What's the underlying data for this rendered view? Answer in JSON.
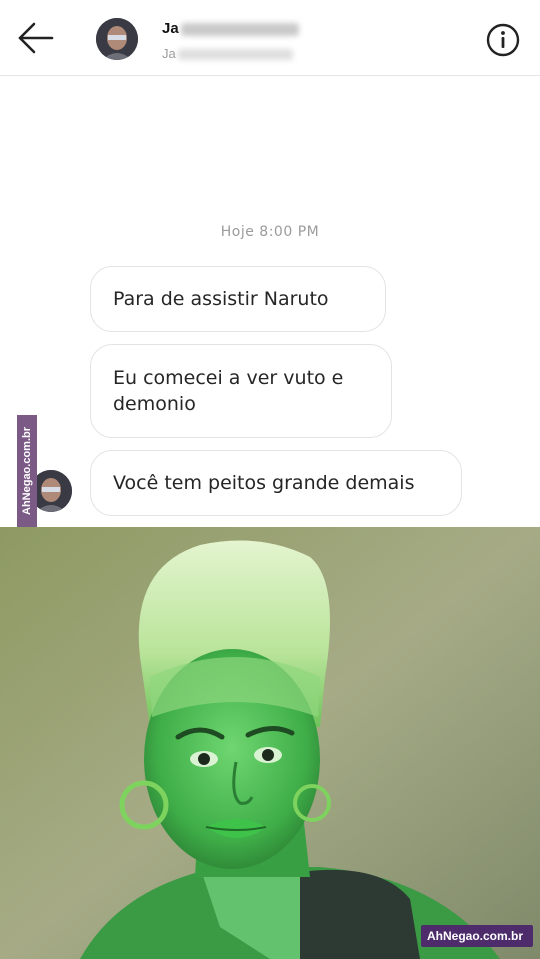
{
  "header": {
    "name_visible": "Ja",
    "username_visible": "Ja",
    "back_icon": "arrow-left-icon",
    "info_icon": "info-circle-icon"
  },
  "chat": {
    "timestamp": "Hoje 8:00 PM",
    "messages": [
      {
        "text": "Para de assistir Naruto"
      },
      {
        "text": "Eu comecei a ver vuto e demonio"
      },
      {
        "text": "Você tem peitos grande demais"
      }
    ]
  },
  "watermarks": {
    "side": "AhNegao.com.br",
    "bottom": "AhNegao.com.br"
  },
  "colors": {
    "bubble_border": "#e3e3e3",
    "timestamp": "#9b9b9b",
    "meme_green": "#4fbf54",
    "watermark_purple": "#4e2c6c"
  }
}
